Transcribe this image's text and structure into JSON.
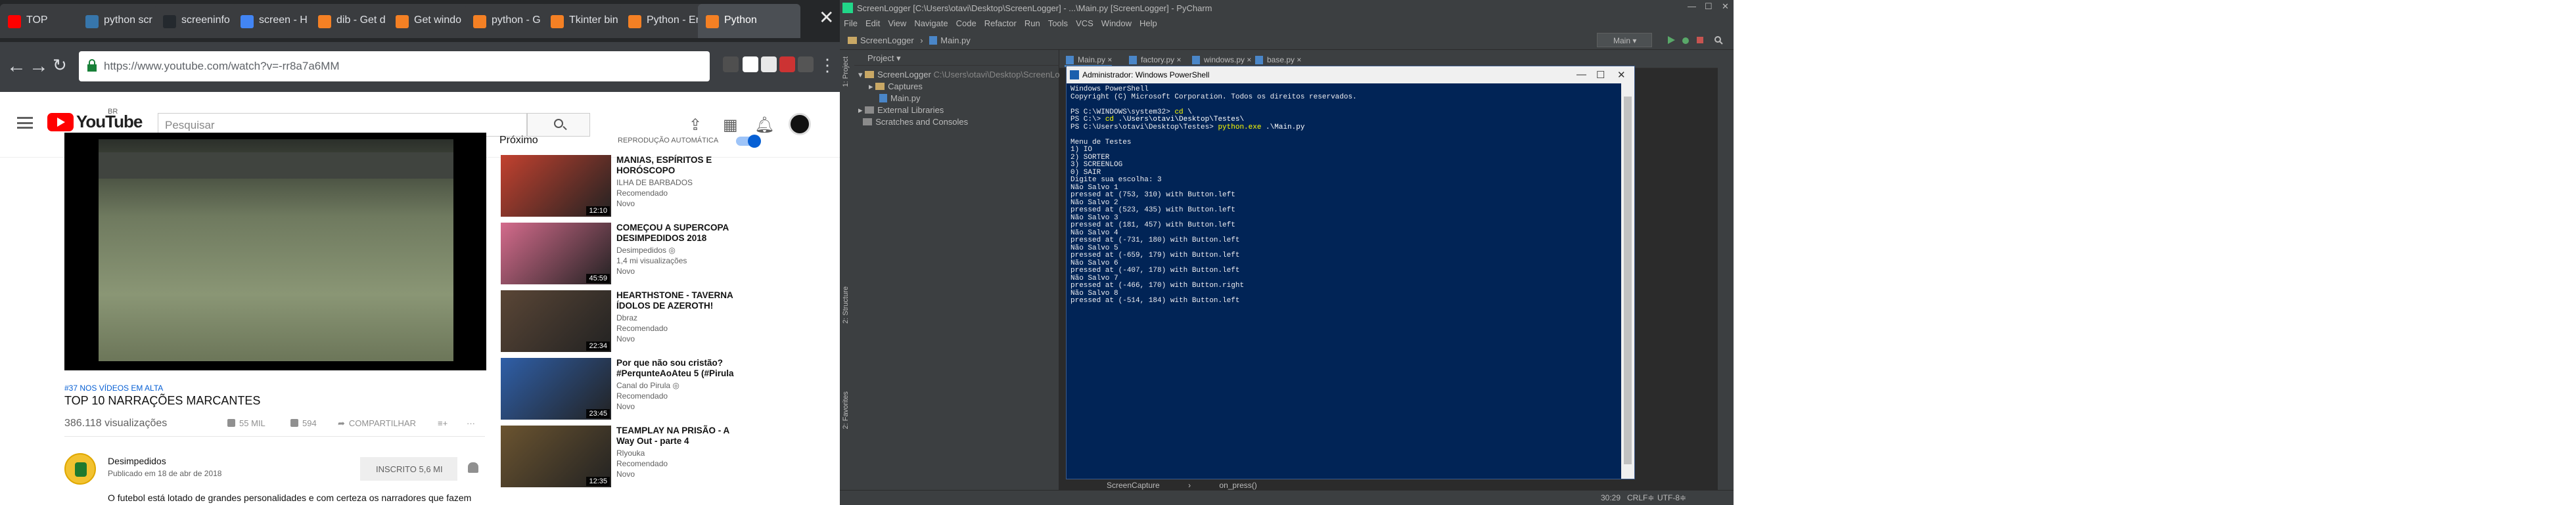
{
  "chrome": {
    "tabs": [
      {
        "label": "TOP",
        "color": "#ff0000",
        "active": false
      },
      {
        "label": "python scr",
        "color": "#3776ab",
        "active": false
      },
      {
        "label": "screeninfo",
        "color": "#24292e",
        "active": false
      },
      {
        "label": "screen - H",
        "color": "#4285f4",
        "active": false
      },
      {
        "label": "dib - Get d",
        "color": "#f48024",
        "active": false
      },
      {
        "label": "Get windo",
        "color": "#f48024",
        "active": false
      },
      {
        "label": "python - G",
        "color": "#f48024",
        "active": false
      },
      {
        "label": "Tkinter bin",
        "color": "#f48024",
        "active": false
      },
      {
        "label": "Python - Er",
        "color": "#f48024",
        "active": false
      },
      {
        "label": "Python",
        "color": "#f48024",
        "active": true
      }
    ],
    "url": "https://www.youtube.com/watch?v=-rr8a7a6MM"
  },
  "youtube": {
    "brand": "YouTube",
    "brand_region": "BR",
    "search_placeholder": "Pesquisar",
    "hashtags": "#37 NOS VÍDEOS EM ALTA",
    "title": "TOP 10 NARRAÇÕES MARCANTES",
    "views": "386.118 visualizações",
    "likes": "55 MIL",
    "dislikes": "594",
    "share": "COMPARTILHAR",
    "channel": "Desimpedidos",
    "published": "Publicado em 18 de abr de 2018",
    "subscribe": "INSCRITO  5,6 MI",
    "description": "O futebol está lotado de grandes personalidades e com certeza os narradores que fazem",
    "next_label": "Próximo",
    "autoplay_label": "REPRODUÇÃO AUTOMÁTICA",
    "autoplay_on": true,
    "recommendations": [
      {
        "title": "MANIAS, ESPÍRITOS E HORÓSCOPO",
        "channel": "ILHA DE BARBADOS",
        "line2": "Recomendado",
        "badge": "Novo",
        "duration": "12:10",
        "thumb": "#c2412f"
      },
      {
        "title": "COMEÇOU A SUPERCOPA DESIMPEDIDOS 2018",
        "channel": "Desimpedidos ◎",
        "line2": "1,4 mi visualizações",
        "badge": "Novo",
        "duration": "45:59",
        "thumb": "#d46b8c"
      },
      {
        "title": "HEARTHSTONE - TAVERNA ÍDOLOS DE AZEROTH!",
        "channel": "Dbraz",
        "line2": "Recomendado",
        "badge": "Novo",
        "duration": "22:34",
        "thumb": "#5a4636"
      },
      {
        "title": "Por que não sou cristão? #PerqunteAoAteu 5 (#Pirula",
        "channel": "Canal do Pirula ◎",
        "line2": "Recomendado",
        "badge": "Novo",
        "duration": "23:45",
        "thumb": "#2f5fa8"
      },
      {
        "title": "TEAMPLAY NA PRISÃO - A Way Out - parte 4",
        "channel": "Rlyouka",
        "line2": "Recomendado",
        "badge": "Novo",
        "duration": "12:35",
        "thumb": "#6b5430"
      }
    ]
  },
  "pycharm": {
    "title": "ScreenLogger [C:\\Users\\otavi\\Desktop\\ScreenLogger] - ...\\Main.py [ScreenLogger] - PyCharm",
    "menu": [
      "File",
      "Edit",
      "View",
      "Navigate",
      "Code",
      "Refactor",
      "Run",
      "Tools",
      "VCS",
      "Window",
      "Help"
    ],
    "nav": [
      "ScreenLogger",
      "Main.py"
    ],
    "run_config": "Main",
    "project_label": "Project",
    "tree": {
      "root": "ScreenLogger",
      "root_path": "C:\\Users\\otavi\\Desktop\\ScreenLogger",
      "captures": "Captures",
      "main": "Main.py",
      "external": "External Libraries",
      "scratches": "Scratches and Consoles"
    },
    "editor_tabs": [
      "Main.py",
      "factory.py",
      "windows.py",
      "base.py"
    ],
    "side_labels": [
      "1: Project",
      "2: Structure",
      "2: Favorites"
    ],
    "status": {
      "breadcrumb_left": "ScreenCapture",
      "breadcrumb_right": "on_press()",
      "position": "30:29",
      "line_sep": "CRLF≑",
      "encoding": "UTF-8≑"
    }
  },
  "powershell": {
    "title": "Administrador: Windows PowerShell",
    "lines": [
      {
        "t": "Windows PowerShell"
      },
      {
        "t": "Copyright (C) Microsoft Corporation. Todos os direitos reservados."
      },
      {
        "t": ""
      },
      {
        "prompt": "PS C:\\WINDOWS\\system32> ",
        "cmd": "cd",
        "arg": " \\"
      },
      {
        "prompt": "PS C:\\> ",
        "cmd": "cd",
        "arg": " .\\Users\\otavi\\Desktop\\Testes\\"
      },
      {
        "prompt": "PS C:\\Users\\otavi\\Desktop\\Testes> ",
        "cmd": "python.exe",
        "arg": " .\\Main.py"
      },
      {
        "t": ""
      },
      {
        "t": "Menu de Testes"
      },
      {
        "t": "1) IO"
      },
      {
        "t": "2) SORTER"
      },
      {
        "t": "3) SCREENLOG"
      },
      {
        "t": "0) SAIR"
      },
      {
        "t": "Digite sua escolha: 3"
      },
      {
        "t": "Não Salvo 1"
      },
      {
        "t": "pressed at (753, 310) with Button.left"
      },
      {
        "t": "Não Salvo 2"
      },
      {
        "t": "pressed at (523, 435) with Button.left"
      },
      {
        "t": "Não Salvo 3"
      },
      {
        "t": "pressed at (181, 457) with Button.left"
      },
      {
        "t": "Não Salvo 4"
      },
      {
        "t": "pressed at (-731, 180) with Button.left"
      },
      {
        "t": "Não Salvo 5"
      },
      {
        "t": "pressed at (-659, 179) with Button.left"
      },
      {
        "t": "Não Salvo 6"
      },
      {
        "t": "pressed at (-407, 178) with Button.left"
      },
      {
        "t": "Não Salvo 7"
      },
      {
        "t": "pressed at (-466, 170) with Button.right"
      },
      {
        "t": "Não Salvo 8"
      },
      {
        "t": "pressed at (-514, 184) with Button.left"
      }
    ]
  }
}
